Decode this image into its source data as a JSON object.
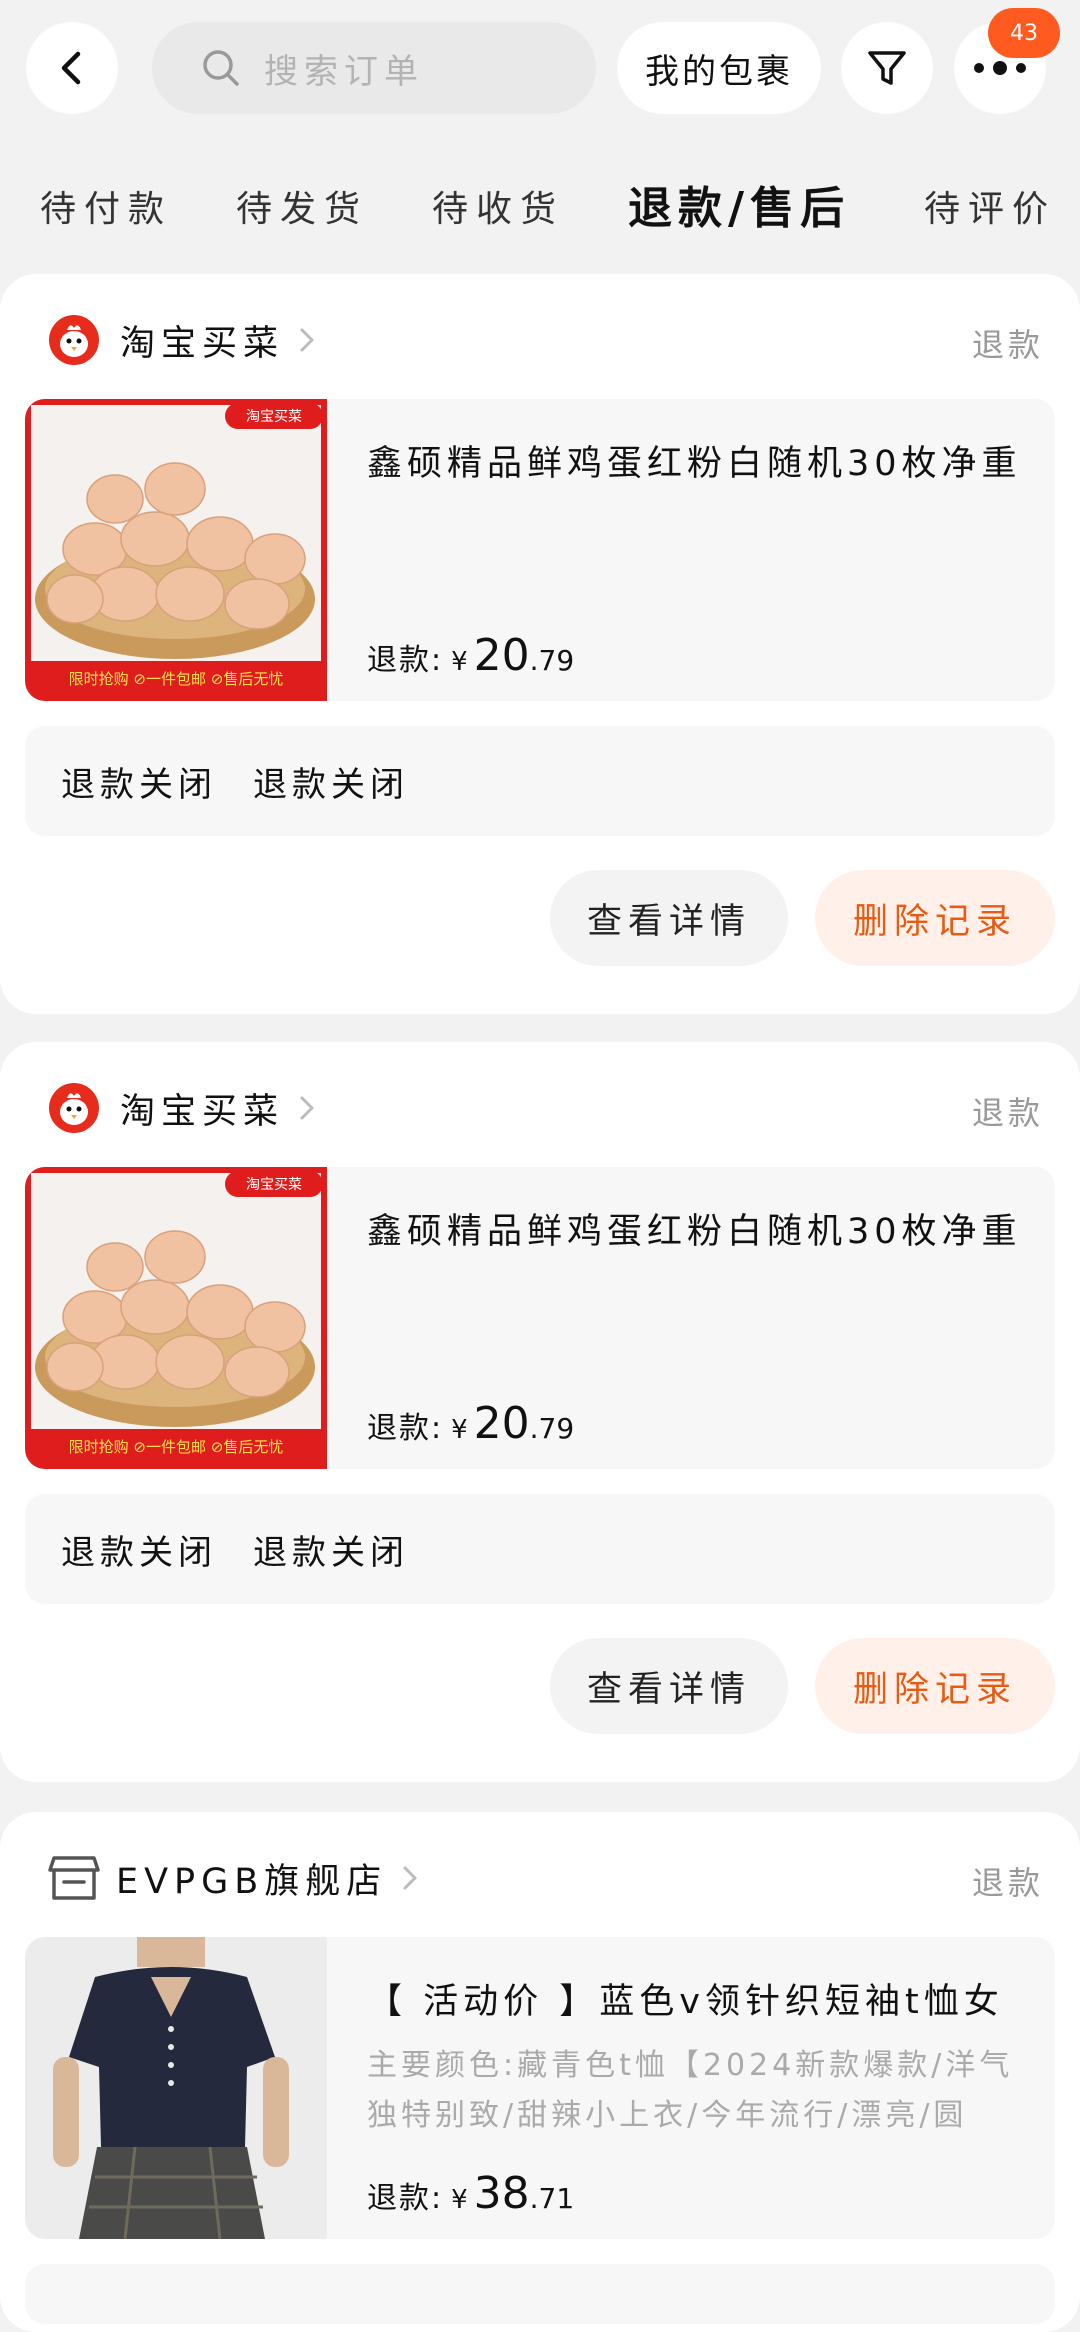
{
  "header": {
    "search_placeholder": "搜索订单",
    "my_packages": "我的包裹",
    "badge_count": "43",
    "icons": [
      "back-arrow-icon",
      "search-icon",
      "filter-icon",
      "more-icon"
    ]
  },
  "tabs": [
    {
      "label": "待付款",
      "active": false
    },
    {
      "label": "待发货",
      "active": false
    },
    {
      "label": "待收货",
      "active": false
    },
    {
      "label": "退款/售后",
      "active": true
    },
    {
      "label": "待评价",
      "active": false
    }
  ],
  "orders": [
    {
      "shop": "淘宝买菜",
      "status": "退款",
      "title": "鑫硕精品鲜鸡蛋红粉白随机30枚净重",
      "price_label": "退款:",
      "currency": "¥",
      "price_int": "20",
      "price_dec": ".79",
      "refund_status_1": "退款关闭",
      "refund_status_2": "退款关闭",
      "btn_detail": "查看详情",
      "btn_delete": "删除记录",
      "img_banner_top": "淘宝买菜",
      "img_banner_bottom": "限时抢购 ⊘一件包邮 ⊘售后无忧"
    },
    {
      "shop": "淘宝买菜",
      "status": "退款",
      "title": "鑫硕精品鲜鸡蛋红粉白随机30枚净重",
      "price_label": "退款:",
      "currency": "¥",
      "price_int": "20",
      "price_dec": ".79",
      "refund_status_1": "退款关闭",
      "refund_status_2": "退款关闭",
      "btn_detail": "查看详情",
      "btn_delete": "删除记录",
      "img_banner_top": "淘宝买菜",
      "img_banner_bottom": "限时抢购 ⊘一件包邮 ⊘售后无忧"
    },
    {
      "shop": "EVPGB旗舰店",
      "status": "退款",
      "title": "【 活动价 】蓝色v领针织短袖t恤女",
      "desc": "主要颜色:藏青色t恤【2024新款爆款/洋气独特别致/甜辣小上衣/今年流行/漂亮/圆",
      "price_label": "退款:",
      "currency": "¥",
      "price_int": "38",
      "price_dec": ".71"
    }
  ],
  "colors": {
    "accent": "#ea5a13",
    "badge": "#ff5a1f",
    "page_bg": "#f2f2f2",
    "egg_banner_red": "#e01d1d"
  }
}
